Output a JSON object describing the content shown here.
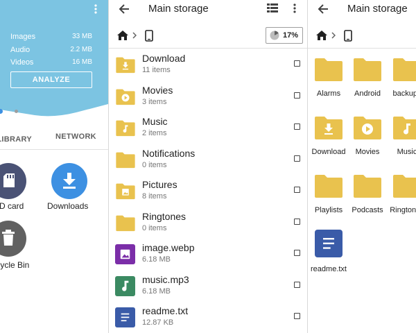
{
  "left": {
    "stats": [
      {
        "label": "Images",
        "value": "33 MB"
      },
      {
        "label": "Audio",
        "value": "2.2 MB"
      },
      {
        "label": "Videos",
        "value": "16 MB"
      }
    ],
    "analyze_label": "ANALYZE",
    "tabs": [
      "LIBRARY",
      "NETWORK"
    ],
    "shortcuts": [
      {
        "label": "SD card",
        "icon": "sd-card-icon"
      },
      {
        "label": "Downloads",
        "icon": "download-icon"
      },
      {
        "label": "Recycle Bin",
        "icon": "trash-icon"
      }
    ],
    "colors": {
      "header": "#7cc4e2",
      "download_circle": "#3d90e2",
      "dark_circle": "#4a5275"
    }
  },
  "middle": {
    "title": "Main storage",
    "storage_percent": "17%",
    "storage_fraction": 0.17,
    "items": [
      {
        "name": "Download",
        "sub": "11 items",
        "icon": "folder-download-icon"
      },
      {
        "name": "Movies",
        "sub": "3 items",
        "icon": "folder-movies-icon"
      },
      {
        "name": "Music",
        "sub": "2 items",
        "icon": "folder-music-icon"
      },
      {
        "name": "Notifications",
        "sub": "0 items",
        "icon": "folder-icon"
      },
      {
        "name": "Pictures",
        "sub": "8 items",
        "icon": "folder-pictures-icon"
      },
      {
        "name": "Ringtones",
        "sub": "0 items",
        "icon": "folder-icon"
      },
      {
        "name": "image.webp",
        "sub": "6.18 MB",
        "icon": "image-file-icon"
      },
      {
        "name": "music.mp3",
        "sub": "6.18 MB",
        "icon": "audio-file-icon"
      },
      {
        "name": "readme.txt",
        "sub": "12.87 KB",
        "icon": "text-file-icon"
      }
    ],
    "colors": {
      "folder": "#e9c24e",
      "image_file": "#7b2ea8",
      "audio_file": "#3b8a62",
      "text_file": "#3a5ba8"
    }
  },
  "right": {
    "title": "Main storage",
    "grid": [
      {
        "name": "Alarms",
        "icon": "folder-icon"
      },
      {
        "name": "Android",
        "icon": "folder-icon"
      },
      {
        "name": "backups",
        "icon": "folder-icon"
      },
      {
        "name": "Download",
        "icon": "folder-download-icon"
      },
      {
        "name": "Movies",
        "icon": "folder-movies-icon"
      },
      {
        "name": "Music",
        "icon": "folder-music-icon"
      },
      {
        "name": "Playlists",
        "icon": "folder-icon"
      },
      {
        "name": "Podcasts",
        "icon": "folder-icon"
      },
      {
        "name": "Ringtones",
        "icon": "folder-icon"
      },
      {
        "name": "readme.txt",
        "icon": "text-file-icon"
      }
    ]
  }
}
